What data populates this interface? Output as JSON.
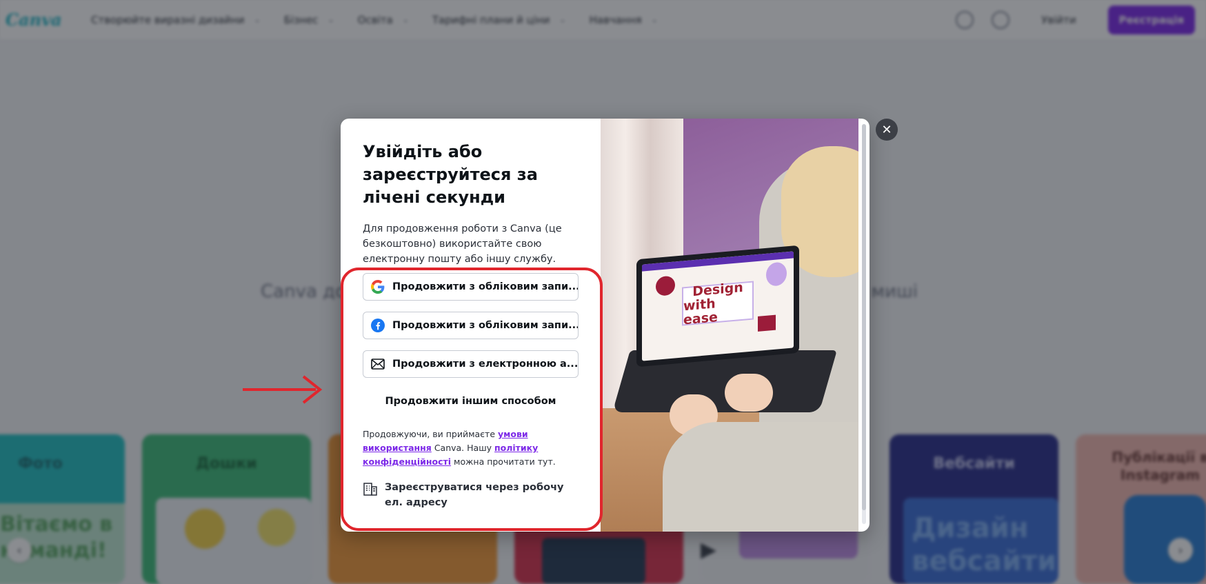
{
  "background": {
    "logo": "Canva",
    "nav_items": [
      {
        "label": "Створюйте виразні дизайни"
      },
      {
        "label": "Бізнес"
      },
      {
        "label": "Освіта"
      },
      {
        "label": "Тарифні плани й ціни"
      },
      {
        "label": "Навчання"
      }
    ],
    "login_label": "Увійти",
    "signup_label": "Реєстрація",
    "hero_text_left": "Canva до",
    "hero_text_right": "ї миші",
    "cards": [
      {
        "title": "Фото",
        "inner_text": "Вітаємо в команді!"
      },
      {
        "title": "Дошки"
      },
      {
        "title": ""
      },
      {
        "title": ""
      },
      {
        "title": ""
      },
      {
        "title": "Вебсайти",
        "inner_text": "Дизайн вебсайти"
      },
      {
        "title": "Публікації в Instagram"
      }
    ]
  },
  "modal": {
    "title": "Увійдіть або зареєструйтеся за лічені секунди",
    "description": "Для продовження роботи з Canva (це безкоштовно) використайте свою електронну пошту або іншу службу.",
    "buttons": {
      "google": "Продовжити з обліковим запи...",
      "facebook": "Продовжити з обліковим запи...",
      "email": "Продовжити з електронною а..."
    },
    "other_way": "Продовжити іншим способом",
    "terms": {
      "prefix": "Продовжуючи, ви приймаєте ",
      "terms_link": "умови використання",
      "middle": " Canva. Нашу ",
      "privacy_link": "політику конфіденційності",
      "suffix": " можна прочитати тут."
    },
    "work_signup": "Зареєструватися через робочу ел. адресу",
    "image": {
      "screen_text_line1": "Design",
      "screen_text_line2": "with ease"
    },
    "close_icon": "close-icon"
  },
  "colors": {
    "accent": "#7d2ae8",
    "highlight": "#e0262d",
    "facebook": "#1877f2"
  }
}
